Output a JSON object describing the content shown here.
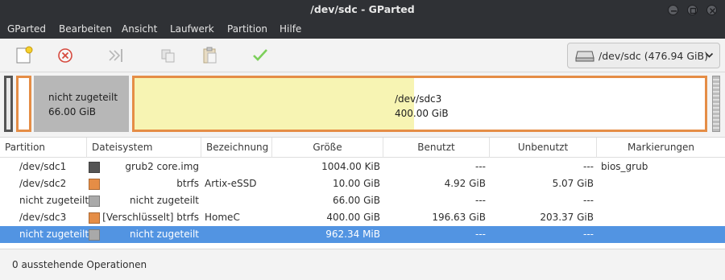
{
  "window": {
    "title": "/dev/sdc - GParted"
  },
  "menu": [
    "GParted",
    "Bearbeiten",
    "Ansicht",
    "Laufwerk",
    "Partition",
    "Hilfe"
  ],
  "device_selector": {
    "device": "/dev/sdc",
    "size": "(476.94 GiB)"
  },
  "graph": {
    "unallocated": {
      "label": "nicht zugeteilt",
      "size": "66.00 GiB"
    },
    "sdc3": {
      "label": "/dev/sdc3",
      "size": "400.00 GiB",
      "used_fraction": 0.49
    }
  },
  "table": {
    "columns": [
      "Partition",
      "Dateisystem",
      "Bezeichnung",
      "Größe",
      "Benutzt",
      "Unbenutzt",
      "Markierungen"
    ],
    "rows": [
      {
        "partition": "/dev/sdc1",
        "fs": "grub2 core.img",
        "label": "",
        "size": "1004.00 KiB",
        "used": "---",
        "unused": "---",
        "flags": "bios_grub",
        "color": "#555555"
      },
      {
        "partition": "/dev/sdc2",
        "fs": "btrfs",
        "label": "Artix-eSSD",
        "size": "10.00 GiB",
        "used": "4.92 GiB",
        "unused": "5.07 GiB",
        "flags": "",
        "color": "#e58d46"
      },
      {
        "partition": "nicht zugeteilt",
        "fs": "nicht zugeteilt",
        "label": "",
        "size": "66.00 GiB",
        "used": "---",
        "unused": "---",
        "flags": "",
        "color": "#a9a9a9"
      },
      {
        "partition": "/dev/sdc3",
        "fs": "[Verschlüsselt] btrfs",
        "label": "HomeC",
        "size": "400.00 GiB",
        "used": "196.63 GiB",
        "unused": "203.37 GiB",
        "flags": "",
        "color": "#e58d46"
      },
      {
        "partition": "nicht zugeteilt",
        "fs": "nicht zugeteilt",
        "label": "",
        "size": "962.34 MiB",
        "used": "---",
        "unused": "---",
        "flags": "",
        "color": "#a9a9a9"
      }
    ]
  },
  "status": {
    "text": "0 ausstehende Operationen"
  },
  "colors": {
    "accent": "#5294e2",
    "btrfs": "#e58d46",
    "unallocated": "#a9a9a9",
    "used_fill": "#f7f4b3"
  },
  "icons": [
    "new-icon",
    "delete-icon",
    "resize-icon",
    "copy-icon",
    "paste-icon",
    "apply-icon",
    "disk-icon",
    "chevron-down-icon",
    "minimize-icon",
    "maximize-icon",
    "close-icon"
  ]
}
